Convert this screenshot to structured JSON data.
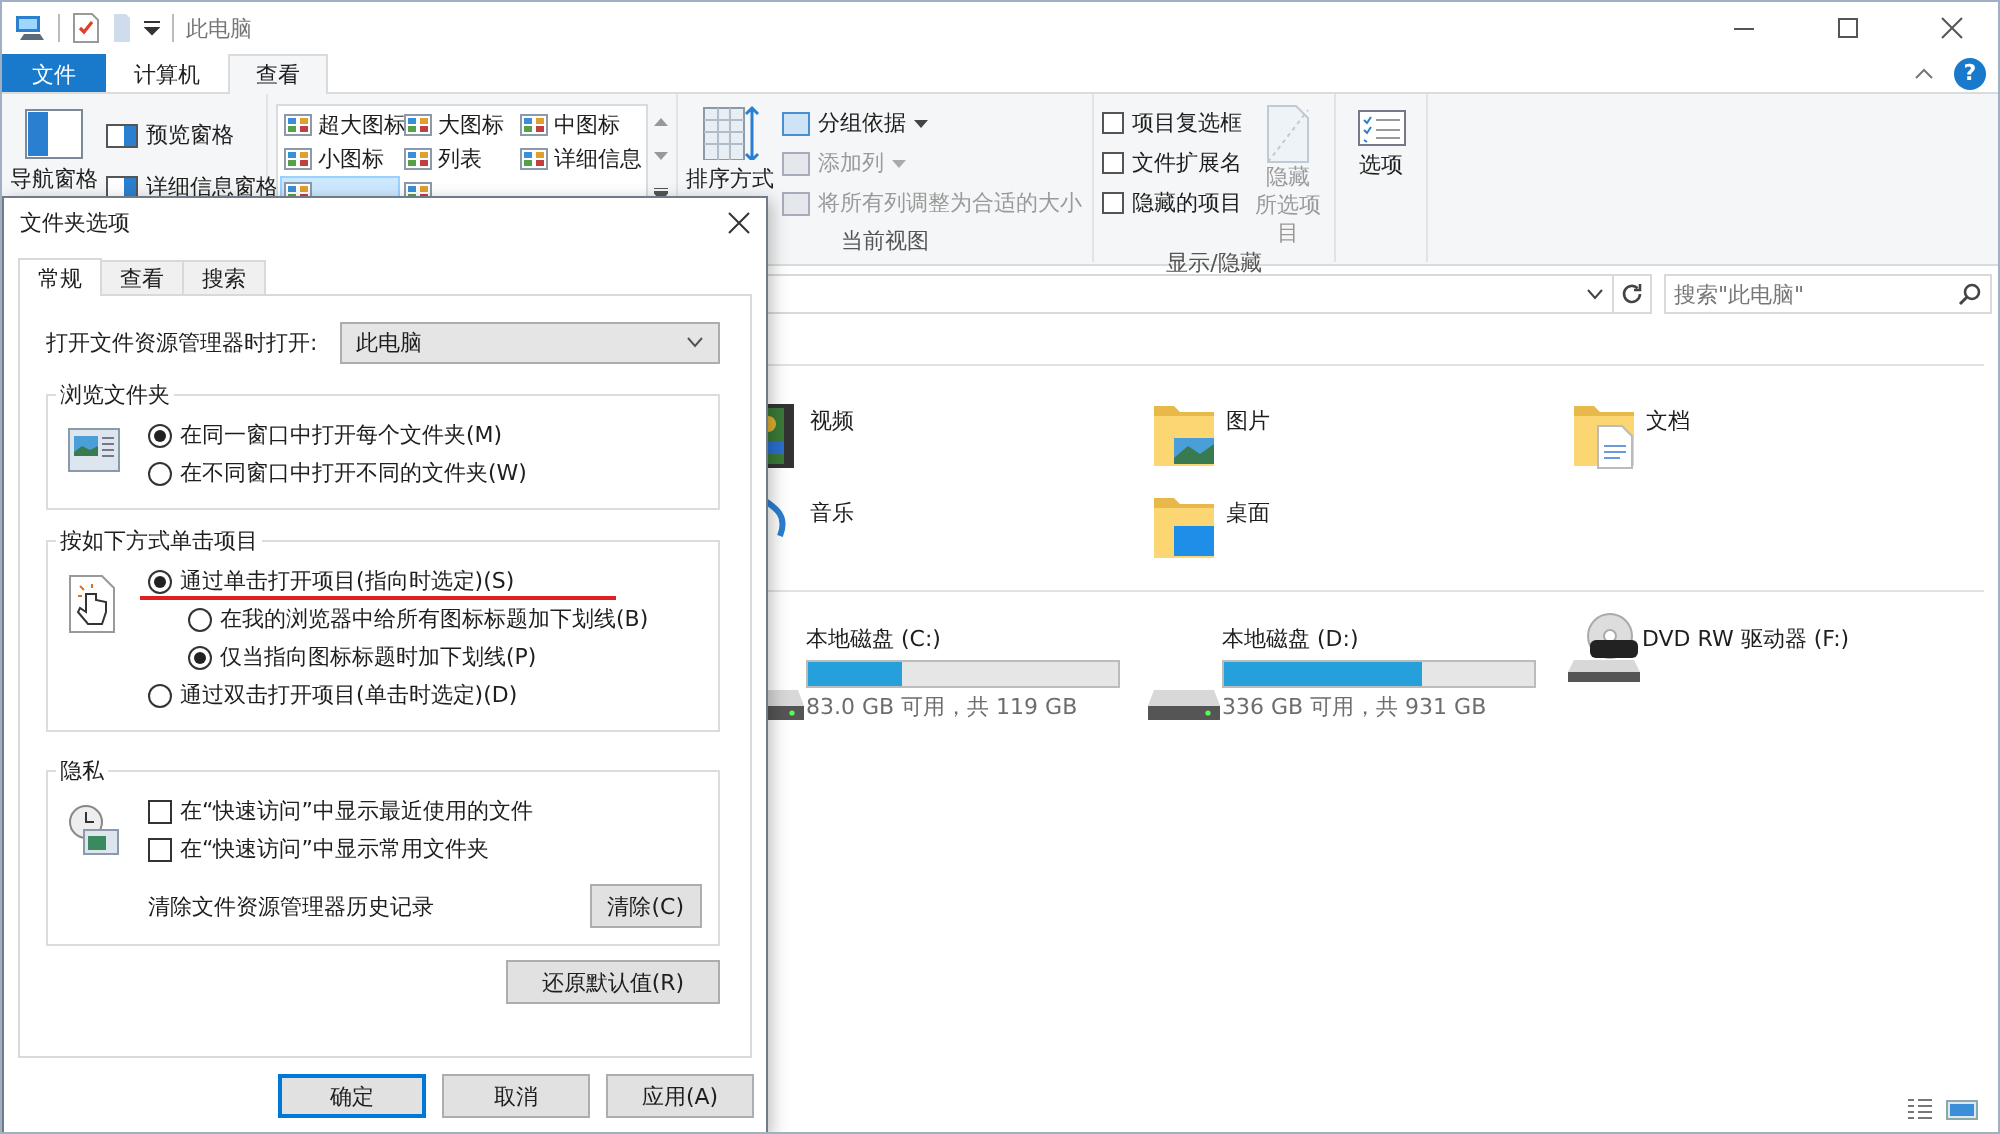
{
  "window": {
    "title": "此电脑"
  },
  "ribbon_tabs": [
    {
      "label": "文件",
      "kind": "file",
      "selected": false
    },
    {
      "label": "计算机",
      "kind": "tab",
      "selected": false
    },
    {
      "label": "查看",
      "kind": "tab",
      "selected": true
    }
  ],
  "ribbon_help": "?",
  "ribbon": {
    "panes": [
      {
        "label": "导航窗格"
      },
      {
        "label": "预览窗格"
      },
      {
        "label": "详细信息窗格"
      }
    ],
    "layouts": [
      {
        "label": "超大图标",
        "selected": false
      },
      {
        "label": "大图标",
        "selected": false
      },
      {
        "label": "中图标",
        "selected": false
      },
      {
        "label": "小图标",
        "selected": false
      },
      {
        "label": "列表",
        "selected": false
      },
      {
        "label": "详细信息",
        "selected": false
      },
      {
        "selected": true
      },
      {
        "selected": false
      }
    ],
    "current_view": {
      "sort": "排序方式",
      "items": [
        {
          "label": "分组依据",
          "disabled": false,
          "dropdown": true
        },
        {
          "label": "添加列",
          "disabled": true,
          "dropdown": true
        },
        {
          "label": "将所有列调整为合适的大小",
          "disabled": true,
          "dropdown": false
        }
      ],
      "caption": "当前视图"
    },
    "show_hide": {
      "checkboxes": [
        {
          "label": "项目复选框",
          "checked": false
        },
        {
          "label": "文件扩展名",
          "checked": false
        },
        {
          "label": "隐藏的项目",
          "checked": false
        }
      ],
      "hide_selected": {
        "lines": [
          "隐藏",
          "所选项目"
        ],
        "disabled": true
      },
      "caption": "显示/隐藏"
    },
    "options": "选项"
  },
  "search": {
    "placeholder": "搜索\"此电脑\""
  },
  "folders": [
    {
      "name": "视频",
      "kind": "video"
    },
    {
      "name": "图片",
      "kind": "pictures"
    },
    {
      "name": "文档",
      "kind": "documents"
    },
    {
      "name": "音乐",
      "kind": "music"
    },
    {
      "name": "桌面",
      "kind": "desktop"
    }
  ],
  "drives": [
    {
      "name": "本地磁盘 (C:)",
      "kind": "disk",
      "level": 0.3,
      "reading": "83.0 GB 可用，共 119 GB"
    },
    {
      "name": "本地磁盘 (D:)",
      "kind": "disk",
      "level": 0.64,
      "reading": "336 GB 可用，共 931 GB"
    },
    {
      "name": "DVD RW 驱动器 (F:)",
      "kind": "dvd"
    }
  ],
  "dialog": {
    "title": "文件夹选项",
    "tabs": [
      {
        "label": "常规",
        "selected": true
      },
      {
        "label": "查看",
        "selected": false
      },
      {
        "label": "搜索",
        "selected": false
      }
    ],
    "open_in": {
      "label": "打开文件资源管理器时打开:",
      "value": "此电脑"
    },
    "groups": [
      {
        "title": "浏览文件夹",
        "options": [
          {
            "label": "在同一窗口中打开每个文件夹(M)",
            "kind": "radio",
            "selected": true,
            "annotated": false
          },
          {
            "label": "在不同窗口中打开不同的文件夹(W)",
            "kind": "radio",
            "selected": false,
            "annotated": false
          }
        ]
      },
      {
        "title": "按如下方式单击项目",
        "options": [
          {
            "label": "通过单击打开项目(指向时选定)(S)",
            "kind": "radio",
            "selected": true,
            "annotated": true,
            "children": [
              {
                "label": "在我的浏览器中给所有图标标题加下划线(B)",
                "kind": "radio",
                "selected": false,
                "annotated": false
              },
              {
                "label": "仅当指向图标标题时加下划线(P)",
                "kind": "radio",
                "selected": true,
                "annotated": false
              }
            ]
          },
          {
            "label": "通过双击打开项目(单击时选定)(D)",
            "kind": "radio",
            "selected": false,
            "annotated": false
          }
        ]
      },
      {
        "title": "隐私",
        "options": [
          {
            "label": "在“快速访问”中显示最近使用的文件",
            "kind": "checkbox",
            "checked": false
          },
          {
            "label": "在“快速访问”中显示常用文件夹",
            "kind": "checkbox",
            "checked": false
          }
        ],
        "action": {
          "label": "清除文件资源管理器历史记录",
          "button": "清除(C)"
        }
      }
    ],
    "restore_button": "还原默认值(R)",
    "buttons": [
      {
        "label": "确定",
        "default": true
      },
      {
        "label": "取消",
        "default": false
      },
      {
        "label": "应用(A)",
        "default": false
      }
    ]
  }
}
